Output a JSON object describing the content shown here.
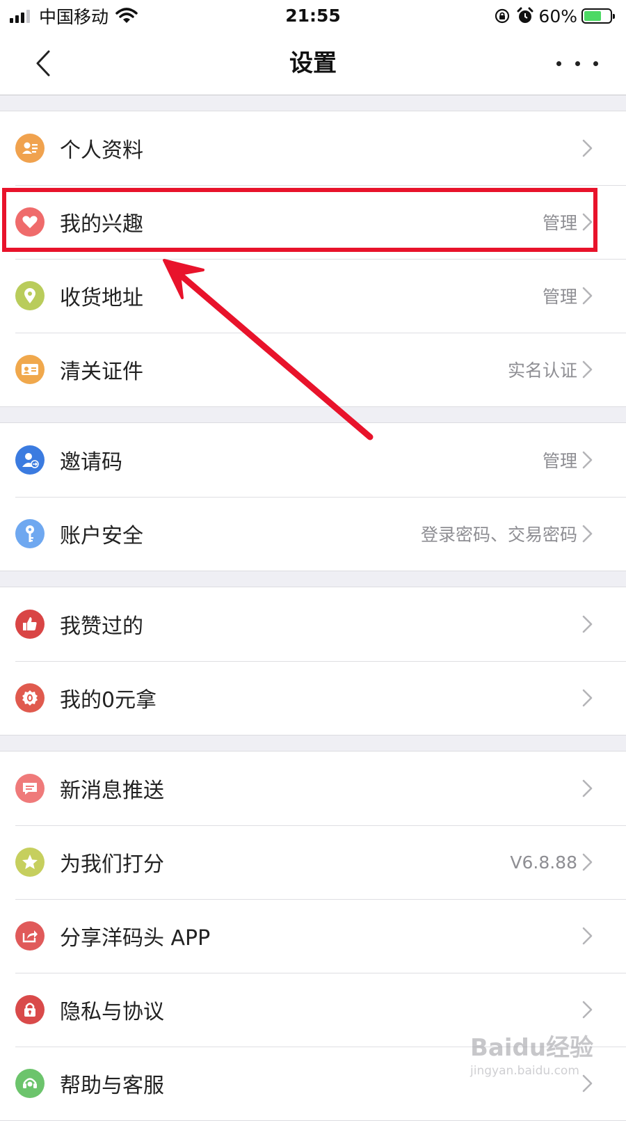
{
  "status_bar": {
    "carrier": "中国移动",
    "time": "21:55",
    "battery_percent": "60%",
    "battery_level": 0.6,
    "signal_bars": 3,
    "icons": [
      "signal-icon",
      "wifi-icon",
      "rotation-lock-icon",
      "alarm-icon",
      "battery-charging-icon"
    ]
  },
  "nav": {
    "title": "设置",
    "back_icon": "chevron-left-icon",
    "more_icon": "more-dots-icon"
  },
  "groups": [
    {
      "items": [
        {
          "label": "个人资料",
          "value": "",
          "icon": "profile-card-icon",
          "color": "#f0a24e"
        },
        {
          "label": "我的兴趣",
          "value": "管理",
          "icon": "heart-icon",
          "color": "#ef6b6b"
        },
        {
          "label": "收货地址",
          "value": "管理",
          "icon": "location-pin-icon",
          "color": "#b9cc5b"
        },
        {
          "label": "清关证件",
          "value": "实名认证",
          "icon": "id-card-icon",
          "color": "#f0a84c"
        }
      ]
    },
    {
      "items": [
        {
          "label": "邀请码",
          "value": "管理",
          "icon": "invite-user-icon",
          "color": "#3b7be0"
        },
        {
          "label": "账户安全",
          "value": "登录密码、交易密码",
          "icon": "key-icon",
          "color": "#6fa8f0"
        }
      ]
    },
    {
      "items": [
        {
          "label": "我赞过的",
          "value": "",
          "icon": "thumbs-up-icon",
          "color": "#d94545"
        },
        {
          "label": "我的0元拿",
          "value": "",
          "icon": "zero-badge-icon",
          "color": "#e05a4e"
        }
      ]
    },
    {
      "items": [
        {
          "label": "新消息推送",
          "value": "",
          "icon": "message-icon",
          "color": "#ef7a7a"
        },
        {
          "label": "为我们打分",
          "value": "V6.8.88",
          "icon": "star-icon",
          "color": "#c6cf5e"
        },
        {
          "label": "分享洋码头 APP",
          "value": "",
          "icon": "share-icon",
          "color": "#e05a5a"
        },
        {
          "label": "隐私与协议",
          "value": "",
          "icon": "lock-icon",
          "color": "#d94a4a"
        },
        {
          "label": "帮助与客服",
          "value": "",
          "icon": "headset-icon",
          "color": "#6cc46c"
        }
      ]
    }
  ],
  "watermark": {
    "main": "Baidu经验",
    "sub": "jingyan.baidu.com"
  }
}
